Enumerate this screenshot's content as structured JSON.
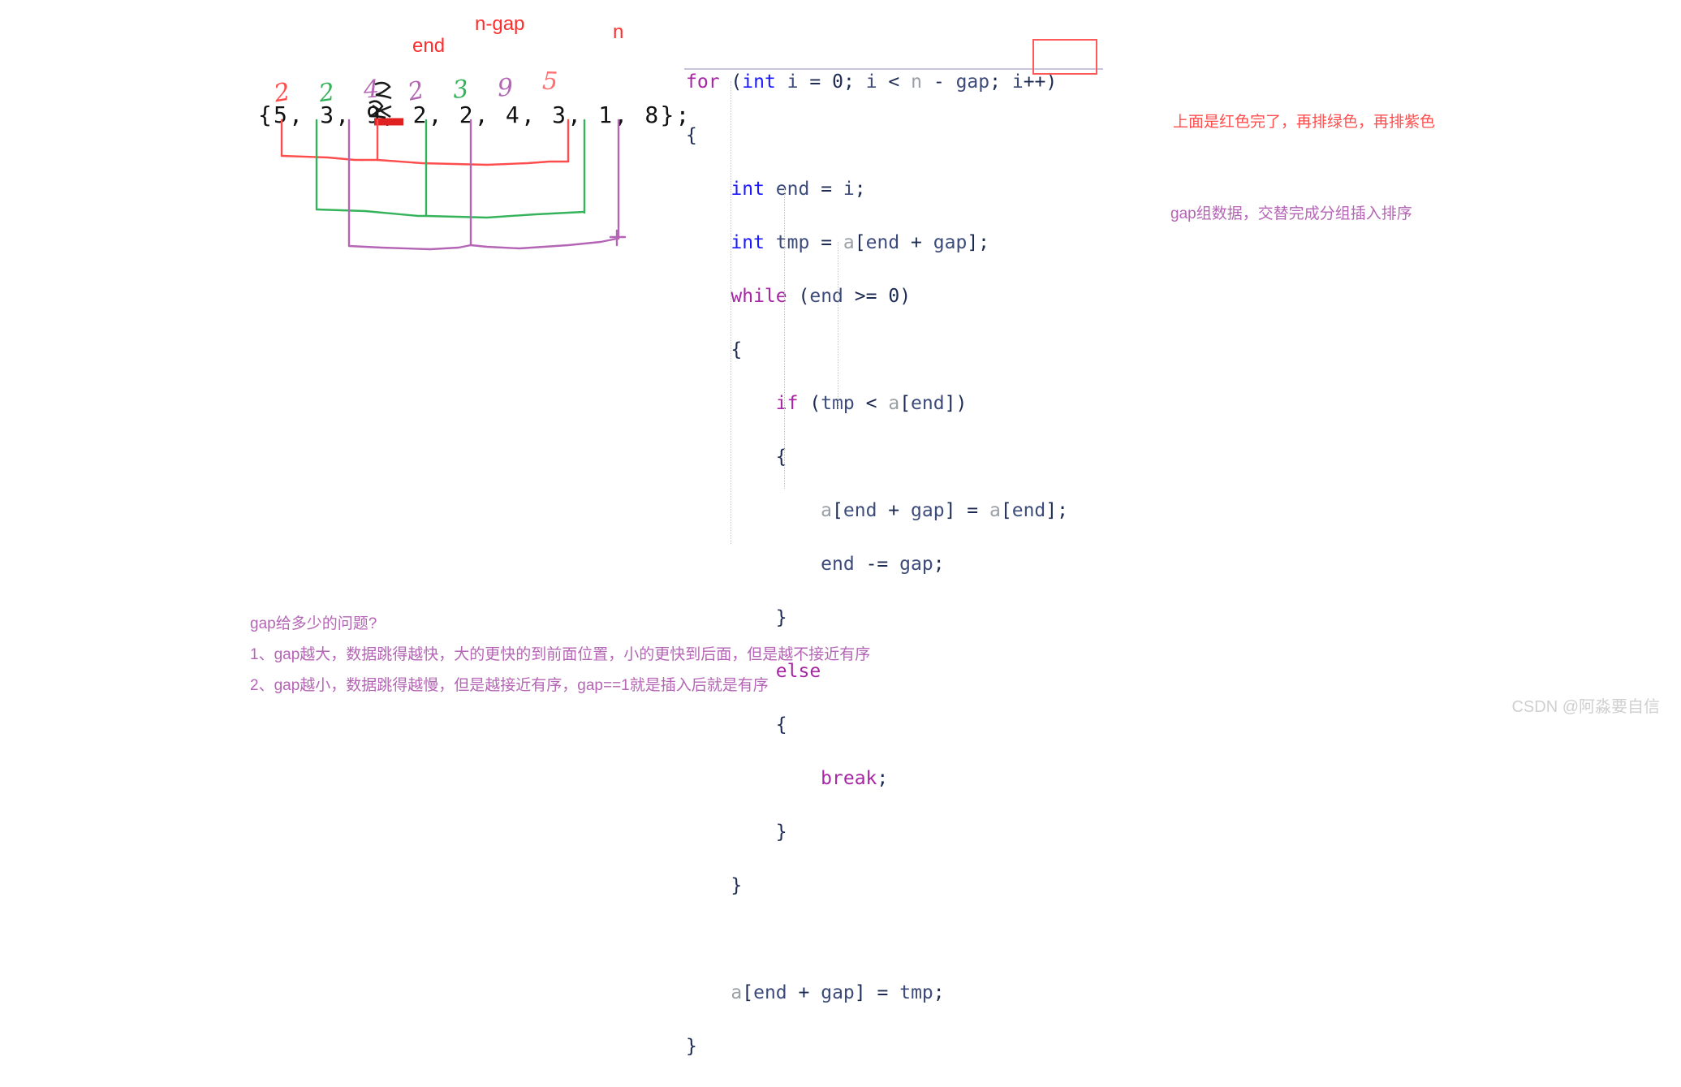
{
  "diagram": {
    "labels": [
      {
        "id": "end",
        "text": "end"
      },
      {
        "id": "ngap",
        "text": "n-gap"
      },
      {
        "id": "n",
        "text": "n"
      }
    ],
    "array_text": "{5, 3, 9, 2, 2, 4, 3, 1, 8};",
    "array_values": [
      "5",
      "3",
      "9",
      "2",
      "2",
      "4",
      "3",
      "1",
      "8"
    ],
    "handwritten_digits": [
      {
        "value": "2",
        "color": "#ff4d4d",
        "over_index": 0
      },
      {
        "value": "2",
        "color": "#35b35b",
        "over_index": 1
      },
      {
        "value": "4",
        "color": "#b565b5",
        "over_index": 2
      },
      {
        "value": "2",
        "color": "#b565b5",
        "over_index": 3
      },
      {
        "value": "3",
        "color": "#35b35b",
        "over_index": 4
      },
      {
        "value": "9",
        "color": "#b565b5",
        "over_index": 5
      },
      {
        "value": "5",
        "color": "#ff7070",
        "over_index": 6
      }
    ],
    "group_colors": {
      "red": "#ff4d4d",
      "green": "#35b35b",
      "purple": "#b565b5",
      "strike": "#e02020"
    }
  },
  "code": {
    "language": "C",
    "lines": [
      "for (int i = 0; i < n - gap; i++)",
      "{",
      "    int end = i;",
      "    int tmp = a[end + gap];",
      "    while (end >= 0)",
      "    {",
      "        if (tmp < a[end])",
      "        {",
      "            a[end + gap] = a[end];",
      "            end -= gap;",
      "        }",
      "        else",
      "        {",
      "            break;",
      "        }",
      "    }",
      "",
      "    a[end + gap] = tmp;",
      "}"
    ],
    "highlight_box_text": "i++)"
  },
  "notes": {
    "red": "上面是红色完了，再排绿色，再排紫色",
    "purple": "gap组数据，交替完成分组插入排序"
  },
  "bottom_notes": {
    "title": "gap给多少的问题?",
    "items": [
      "1、gap越大，数据跳得越快，大的更快的到前面位置，小的更快到后面，但是越不接近有序",
      "2、gap越小，数据跳得越慢，但是越接近有序，gap==1就是插入后就是有序"
    ]
  },
  "watermark": {
    "text": "CSDN @阿淼要自信"
  }
}
